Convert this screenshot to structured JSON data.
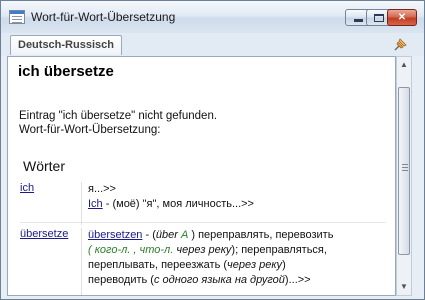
{
  "window": {
    "title": "Wort-für-Wort-Übersetzung"
  },
  "titlebar_buttons": {
    "minimize_icon": "minimize-icon",
    "maximize_icon": "maximize-icon",
    "close_label": "✕"
  },
  "toolbar": {
    "dictionary_tab": "Deutsch-Russisch",
    "pin_icon": "pin-icon"
  },
  "content": {
    "entry_heading": "ich übersetze",
    "not_found_message": "Eintrag \"ich übersetze\" nicht gefunden.",
    "mode_label": "Wort-für-Wort-Übersetzung:",
    "section_title": "Wörter",
    "words": [
      {
        "word": "ich",
        "line1": "я...>>",
        "line2_link": "Ich",
        "line2_rest": " - (моё) \"я\", моя личность...>>"
      },
      {
        "word": "übersetze",
        "link": "übersetzen",
        "p1": " - (",
        "p1_it": "über",
        "p1_green": "A",
        "p2": " ) переправлять, перевозить",
        "p3_green": "( кого-л. , что-л.",
        "p3_it": "через реку",
        "p3_rest": "); переправляться,",
        "p4": "переплывать, переезжать (",
        "p4_it": "через реку",
        "p4_end": ")",
        "p5": "переводить (",
        "p5_it": "с одного языка на другой",
        "p5_end": ")...>>"
      }
    ]
  },
  "scrollbar": {
    "up_icon": "▲",
    "down_icon": "▼"
  },
  "colors": {
    "link": "#1a1a8c",
    "green_italic": "#2a7d2a"
  }
}
